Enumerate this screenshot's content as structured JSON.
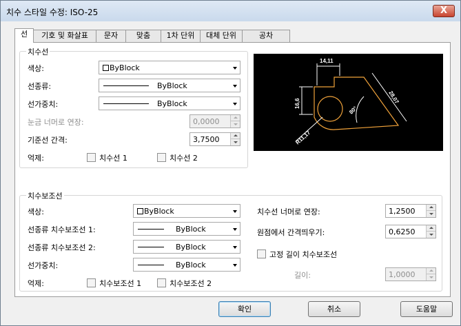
{
  "window": {
    "title": "치수 스타일 수정: ISO-25",
    "close_label": "X"
  },
  "tabs": [
    "선",
    "기호 및 화살표",
    "문자",
    "맞춤",
    "1차 단위",
    "대체 단위",
    "공차"
  ],
  "dim_lines": {
    "group_title": "치수선",
    "color_label": "색상:",
    "color_value": "ByBlock",
    "linetype_label": "선종류:",
    "linetype_value": "ByBlock",
    "lineweight_label": "선가중치:",
    "lineweight_value": "ByBlock",
    "extend_label": "눈금 너머로 연장:",
    "extend_value": "0,0000",
    "baseline_label": "기준선 간격:",
    "baseline_value": "3,7500",
    "suppress_label": "억제:",
    "suppress_1": "치수선 1",
    "suppress_2": "치수선 2"
  },
  "ext_lines": {
    "group_title": "치수보조선",
    "color_label": "색상:",
    "color_value": "ByBlock",
    "linetype1_label": "선종류 치수보조선 1:",
    "linetype1_value": "ByBlock",
    "linetype2_label": "선종류 치수보조선 2:",
    "linetype2_value": "ByBlock",
    "lineweight_label": "선가중치:",
    "lineweight_value": "ByBlock",
    "suppress_label": "억제:",
    "suppress_1": "치수보조선 1",
    "suppress_2": "치수보조선 2",
    "extend_label": "치수선 너머로 연장:",
    "extend_value": "1,2500",
    "offset_label": "원점에서 간격띄우기:",
    "offset_value": "0,6250",
    "fixed_label": "고정 길이 치수보조선",
    "length_label": "길이:",
    "length_value": "1,0000"
  },
  "preview": {
    "top": "14,11",
    "left": "16,6",
    "right": "28,07",
    "angle": "80°",
    "radius": "R11,17"
  },
  "buttons": {
    "ok": "확인",
    "cancel": "취소",
    "help": "도움말"
  },
  "colors": {
    "preview_bg": "#000000",
    "preview_shape": "#f0a23a",
    "preview_dim": "#ffffff"
  }
}
